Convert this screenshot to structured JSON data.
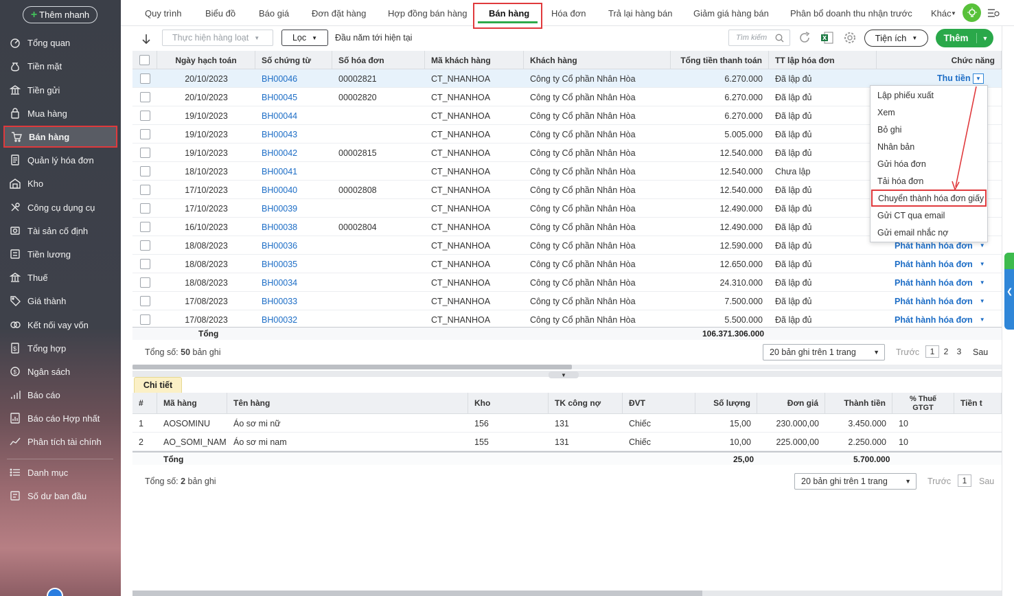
{
  "sidebar": {
    "quick_add": "Thêm nhanh",
    "items": [
      {
        "label": "Tổng quan",
        "icon": "dashboard-icon"
      },
      {
        "label": "Tiền mặt",
        "icon": "money-bag-icon"
      },
      {
        "label": "Tiền gửi",
        "icon": "bank-icon"
      },
      {
        "label": "Mua hàng",
        "icon": "shopping-bag-icon"
      },
      {
        "label": "Bán hàng",
        "icon": "cart-icon"
      },
      {
        "label": "Quản lý hóa đơn",
        "icon": "invoice-icon"
      },
      {
        "label": "Kho",
        "icon": "warehouse-icon"
      },
      {
        "label": "Công cụ dụng cụ",
        "icon": "tools-icon"
      },
      {
        "label": "Tài sản cố định",
        "icon": "asset-icon"
      },
      {
        "label": "Tiền lương",
        "icon": "payroll-icon"
      },
      {
        "label": "Thuế",
        "icon": "tax-icon"
      },
      {
        "label": "Giá thành",
        "icon": "price-tag-icon"
      },
      {
        "label": "Kết nối vay vốn",
        "icon": "loan-icon"
      },
      {
        "label": "Tổng hợp",
        "icon": "summary-icon"
      },
      {
        "label": "Ngân sách",
        "icon": "budget-icon"
      },
      {
        "label": "Báo cáo",
        "icon": "report-icon"
      },
      {
        "label": "Báo cáo Hợp nhất",
        "icon": "consolidated-report-icon"
      },
      {
        "label": "Phân tích tài chính",
        "icon": "analysis-icon"
      },
      {
        "label": "Danh mục",
        "icon": "list-icon"
      },
      {
        "label": "Số dư ban đầu",
        "icon": "balance-icon"
      }
    ]
  },
  "tabs": [
    "Quy trình",
    "Biểu đồ",
    "Báo giá",
    "Đơn đặt hàng",
    "Hợp đồng bán hàng",
    "Bán hàng",
    "Hóa đơn",
    "Trả lại hàng bán",
    "Giảm giá hàng bán",
    "Phân bổ doanh thu nhận trước",
    "Khác"
  ],
  "toolbar": {
    "batch": "Thực hiện hàng loạt",
    "filter": "Lọc",
    "period": "Đầu năm tới hiện tại",
    "search_placeholder": "Tìm kiếm",
    "tools": "Tiện ích",
    "add": "Thêm"
  },
  "grid": {
    "columns": [
      "Ngày hạch toán",
      "Số chứng từ",
      "Số hóa đơn",
      "Mã khách hàng",
      "Khách hàng",
      "Tổng tiền thanh toán",
      "TT lập hóa đơn",
      "Chức năng"
    ],
    "rows": [
      [
        "20/10/2023",
        "BH00046",
        "00002821",
        "CT_NHANHOA",
        "Công ty Cổ phần Nhân Hòa",
        "6.270.000",
        "Đã lập đủ",
        "Thu tiền"
      ],
      [
        "20/10/2023",
        "BH00045",
        "00002820",
        "CT_NHANHOA",
        "Công ty Cổ phần Nhân Hòa",
        "6.270.000",
        "Đã lập đủ",
        ""
      ],
      [
        "19/10/2023",
        "BH00044",
        "",
        "CT_NHANHOA",
        "Công ty Cổ phần Nhân Hòa",
        "6.270.000",
        "Đã lập đủ",
        ""
      ],
      [
        "19/10/2023",
        "BH00043",
        "",
        "CT_NHANHOA",
        "Công ty Cổ phần Nhân Hòa",
        "5.005.000",
        "Đã lập đủ",
        ""
      ],
      [
        "19/10/2023",
        "BH00042",
        "00002815",
        "CT_NHANHOA",
        "Công ty Cổ phần Nhân Hòa",
        "12.540.000",
        "Đã lập đủ",
        ""
      ],
      [
        "18/10/2023",
        "BH00041",
        "",
        "CT_NHANHOA",
        "Công ty Cổ phần Nhân Hòa",
        "12.540.000",
        "Chưa lập",
        ""
      ],
      [
        "17/10/2023",
        "BH00040",
        "00002808",
        "CT_NHANHOA",
        "Công ty Cổ phần Nhân Hòa",
        "12.540.000",
        "Đã lập đủ",
        ""
      ],
      [
        "17/10/2023",
        "BH00039",
        "",
        "CT_NHANHOA",
        "Công ty Cổ phần Nhân Hòa",
        "12.490.000",
        "Đã lập đủ",
        ""
      ],
      [
        "16/10/2023",
        "BH00038",
        "00002804",
        "CT_NHANHOA",
        "Công ty Cổ phần Nhân Hòa",
        "12.490.000",
        "Đã lập đủ",
        ""
      ],
      [
        "18/08/2023",
        "BH00036",
        "",
        "CT_NHANHOA",
        "Công ty Cổ phần Nhân Hòa",
        "12.590.000",
        "Đã lập đủ",
        "Phát hành hóa đơn"
      ],
      [
        "18/08/2023",
        "BH00035",
        "",
        "CT_NHANHOA",
        "Công ty Cổ phần Nhân Hòa",
        "12.650.000",
        "Đã lập đủ",
        "Phát hành hóa đơn"
      ],
      [
        "18/08/2023",
        "BH00034",
        "",
        "CT_NHANHOA",
        "Công ty Cổ phần Nhân Hòa",
        "24.310.000",
        "Đã lập đủ",
        "Phát hành hóa đơn"
      ],
      [
        "17/08/2023",
        "BH00033",
        "",
        "CT_NHANHOA",
        "Công ty Cổ phần Nhân Hòa",
        "7.500.000",
        "Đã lập đủ",
        "Phát hành hóa đơn"
      ],
      [
        "17/08/2023",
        "BH00032",
        "",
        "CT_NHANHOA",
        "Công ty Cổ phần Nhân Hòa",
        "5.500.000",
        "Đã lập đủ",
        "Phát hành hóa đơn"
      ]
    ],
    "total_label": "Tổng",
    "total_value": "106.371.306.000"
  },
  "pager": {
    "count_prefix": "Tổng số: ",
    "count": "50",
    "count_suffix": " bản ghi",
    "size": "20 bản ghi trên 1 trang",
    "prev": "Trước",
    "pages": [
      "1",
      "2",
      "3"
    ],
    "next": "Sau"
  },
  "menu": {
    "items": [
      "Lập phiếu xuất",
      "Xem",
      "Bỏ ghi",
      "Nhân bản",
      "Gửi hóa đơn",
      "Tải hóa đơn",
      "Chuyển thành hóa đơn giấy",
      "Gửi CT qua email",
      "Gửi email nhắc nợ"
    ]
  },
  "detail": {
    "tab": "Chi tiết",
    "columns": [
      "#",
      "Mã hàng",
      "Tên hàng",
      "Kho",
      "TK công nợ",
      "ĐVT",
      "Số lượng",
      "Đơn giá",
      "Thành tiền",
      "% Thuế GTGT",
      "Tiền t"
    ],
    "rows": [
      [
        "1",
        "AOSOMINU",
        "Áo sơ mi nữ",
        "156",
        "131",
        "Chiếc",
        "15,00",
        "230.000,00",
        "3.450.000",
        "10"
      ],
      [
        "2",
        "AO_SOMI_NAM",
        "Áo sơ mi nam",
        "155",
        "131",
        "Chiếc",
        "10,00",
        "225.000,00",
        "2.250.000",
        "10"
      ]
    ],
    "total_label": "Tổng",
    "total_qty": "25,00",
    "total_amount": "5.700.000",
    "count_prefix": "Tổng số: ",
    "count": "2",
    "count_suffix": " bản ghi",
    "size": "20 bản ghi trên 1 trang",
    "prev": "Trước",
    "page": "1",
    "next": "Sau"
  },
  "colors": {
    "accent_green": "#2aa84a",
    "highlight_red": "#e0393c",
    "link_blue": "#1c6dc6"
  }
}
